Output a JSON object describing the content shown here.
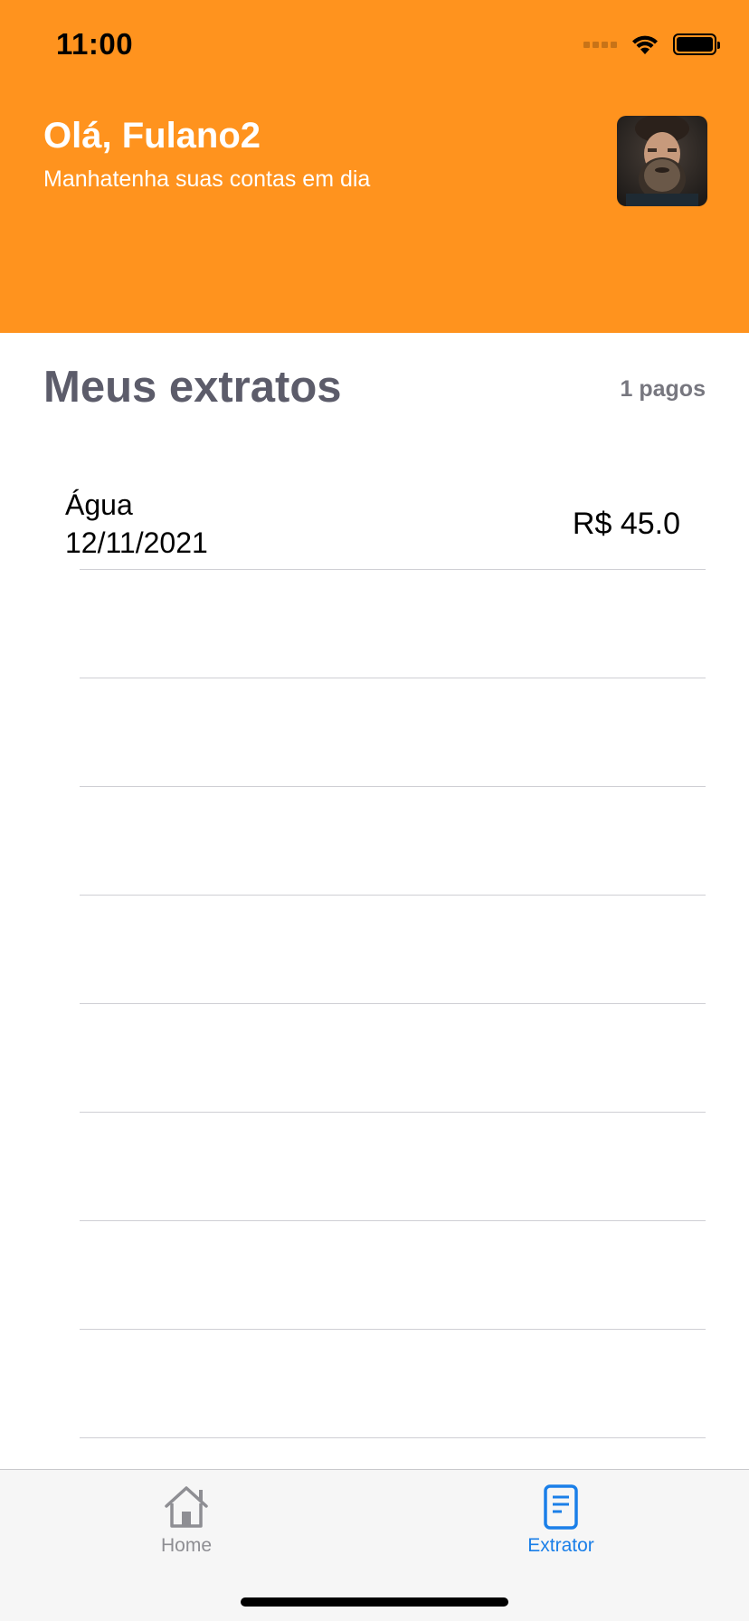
{
  "status_bar": {
    "time": "11:00"
  },
  "header": {
    "greeting": "Olá, Fulano2",
    "subtitle": "Manhatenha suas contas em dia",
    "background_color": "#FF931E"
  },
  "section": {
    "title": "Meus extratos",
    "paid_count": "1 pagos"
  },
  "statements": [
    {
      "name": "Água",
      "date": "12/11/2021",
      "amount": "R$ 45.0"
    }
  ],
  "tab_bar": {
    "tabs": [
      {
        "label": "Home",
        "icon": "home-icon",
        "active": false
      },
      {
        "label": "Extrator",
        "icon": "document-icon",
        "active": true
      }
    ],
    "active_color": "#1a7fe8",
    "inactive_color": "#8e8e93"
  }
}
